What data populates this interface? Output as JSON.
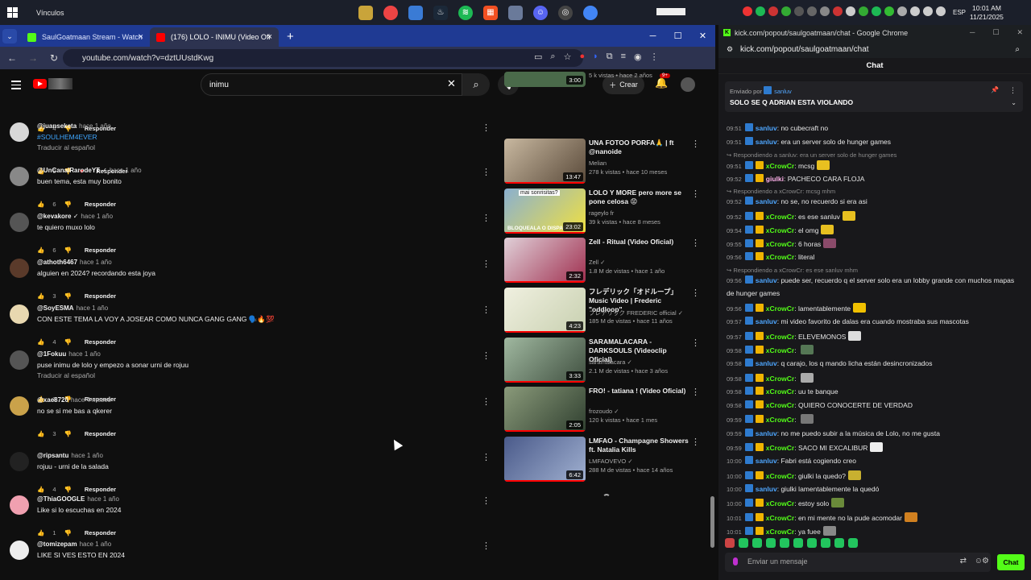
{
  "taskbar": {
    "bookmarks_label": "Vínculos",
    "lang": "ESP",
    "time": "10:01 AM",
    "date": "11/21/2025"
  },
  "browser": {
    "tabs": [
      {
        "label": "SaulGoatmaan Stream - Watch",
        "close": "×"
      },
      {
        "label": "(176) LOLO - INIMU (Video Ofi",
        "close": "×"
      }
    ],
    "new_tab": "+",
    "url": "youtube.com/watch?v=dztUUstdKwg"
  },
  "youtube": {
    "search_value": "inimu",
    "create_label": "Crear",
    "notif_count": "9+",
    "reply_label": "Responder",
    "translate_label": "Traducir al español",
    "first_likes": "4",
    "comments": [
      {
        "user": "@juanseketa",
        "ago": "hace 1 año",
        "text": "#SOULHEM4EVER",
        "link": true,
        "translate": true,
        "likes": "9",
        "creator_heart": true
      },
      {
        "user": "@UnCanalRarodeYT ✓",
        "ago": "hace 1 año",
        "text": "buen tema, esta muy bonito",
        "likes": "6"
      },
      {
        "user": "@kevakore ✓",
        "ago": "hace 1 año",
        "text": "te quiero muxo lolo",
        "likes": "6"
      },
      {
        "user": "@athoth6467",
        "ago": "hace 1 año",
        "text": "alguien en 2024? recordando esta joya",
        "likes": "3"
      },
      {
        "user": "@SoyESMA",
        "ago": "hace 1 año",
        "text": "CON ESTE TEMA LA VOY A JOSEAR COMO NUNCA GANG GANG 🗣️🔥💯",
        "likes": "4"
      },
      {
        "user": "@1Fokuu",
        "ago": "hace 1 año",
        "text": "puse inimu de lolo y empezo a sonar urni de rojuu",
        "translate": true,
        "likes": "3"
      },
      {
        "user": "@xae8720",
        "ago": "hace 4 meses",
        "text": "no se si me bas a qkerer",
        "likes": "3"
      },
      {
        "user": "@ripsantu",
        "ago": "hace 1 año",
        "text": "rojuu - urni de la salada",
        "likes": "4"
      },
      {
        "user": "@ThiaGOOGLE",
        "ago": "hace 1 año",
        "text": "Like si lo escuchas en 2024",
        "likes": "1"
      },
      {
        "user": "@tomizepam",
        "ago": "hace 1 año",
        "text": "LIKE SI VES ESTO EN 2024",
        "likes": ""
      }
    ],
    "top_partial": {
      "meta": "5 k vistas • hace 2 años",
      "duration": "3:00"
    },
    "videos": [
      {
        "title": "UNA FOTOO PORFA🙏 | ft @nanoide",
        "channel": "Melian",
        "meta": "278 k vistas • hace 10 meses",
        "duration": "13:47",
        "thumb_text": ""
      },
      {
        "title": "LOLO Y MORE pero more se pone celosa 😡",
        "channel": "rageylo fr",
        "meta": "39 k vistas • hace 8 meses",
        "duration": "23:02",
        "thumb_text": "mai sonrisitas?",
        "thumb_text2": "BLOQUEALA O DISPARO"
      },
      {
        "title": "Zell - Ritual (Video Oficial)",
        "channel": "Zell ✓",
        "meta": "1.8 M de vistas • hace 1 año",
        "duration": "2:32"
      },
      {
        "title": "フレデリック「オドループ」Music Video | Frederic \"oddloop\"",
        "channel": "フレデリック FREDERIC official ✓",
        "meta": "185 M de vistas • hace 11 años",
        "duration": "4:23"
      },
      {
        "title": "SARAMALACARA - DARKSOULS (Videoclip Oficial)",
        "channel": "saramalacara ✓",
        "meta": "2.1 M de vistas • hace 3 años",
        "duration": "3:33"
      },
      {
        "title": "FRO! - tatiana ! (Video Oficial)",
        "channel": "frozoudo ✓",
        "meta": "120 k vistas • hace 1 mes",
        "duration": "2:05"
      },
      {
        "title": "LMFAO - Champagne Showers ft. Natalia Kills",
        "channel": "LMFAOVEVO ✓",
        "meta": "288 M de vistas • hace 14 años",
        "duration": "6:42"
      }
    ]
  },
  "kick": {
    "window_title": "kick.com/popout/saulgoatmaan/chat - Google Chrome",
    "url": "kick.com/popout/saulgoatmaan/chat",
    "header": "Chat",
    "pinned": {
      "by_prefix": "Enviado por",
      "by_user": "sanluv",
      "message": "SOLO SE Q ADRIAN ESTA VIOLANDO"
    },
    "messages": [
      {
        "ts": "09:51",
        "user": "sanluv",
        "color": "blue",
        "text": "no cubecraft no"
      },
      {
        "ts": "09:51",
        "user": "sanluv",
        "color": "blue",
        "text": "era un server solo de hunger games"
      },
      {
        "reply": "Respondiendo a sanluv: era un server solo de hunger games"
      },
      {
        "ts": "09:51",
        "user": "xCrowCr",
        "color": "green",
        "gold": true,
        "text": "mcsg",
        "emote": "#e8c020"
      },
      {
        "ts": "09:52",
        "user": "giulki",
        "color": "pink",
        "gold": true,
        "text": "PACHECO CARA FLOJA"
      },
      {
        "reply": "Respondiendo a xCrowCr: mcsg mhm"
      },
      {
        "ts": "09:52",
        "user": "sanluv",
        "color": "blue",
        "text": "no se, no recuerdo si era asi"
      },
      {
        "ts": "09:52",
        "user": "xCrowCr",
        "color": "green",
        "gold": true,
        "text": "es ese sanluv",
        "emote": "#e8c020"
      },
      {
        "ts": "09:54",
        "user": "xCrowCr",
        "color": "green",
        "gold": true,
        "text": "el omg",
        "emote": "#e8c020"
      },
      {
        "ts": "09:55",
        "user": "xCrowCr",
        "color": "green",
        "gold": true,
        "text": "6 horas",
        "emote": "#8a4a6a"
      },
      {
        "ts": "09:56",
        "user": "xCrowCr",
        "color": "green",
        "gold": true,
        "text": "literal"
      },
      {
        "reply": "Respondiendo a xCrowCr: es ese sanluv mhm"
      },
      {
        "ts": "09:56",
        "user": "sanluv",
        "color": "blue",
        "text": "puede ser, recuerdo q el server solo era un lobby grande con muchos mapas"
      },
      {
        "cont": "de hunger games"
      },
      {
        "ts": "09:56",
        "user": "xCrowCr",
        "color": "green",
        "gold": true,
        "text": "lamentablemente",
        "emote": "#f0c000"
      },
      {
        "ts": "09:57",
        "user": "sanluv",
        "color": "blue",
        "text": "mi video favorito de dalas era cuando mostraba sus mascotas"
      },
      {
        "ts": "09:57",
        "user": "xCrowCr",
        "color": "green",
        "gold": true,
        "text": "ELEVEMONOS",
        "emote": "#dddddd"
      },
      {
        "ts": "09:58",
        "user": "xCrowCr",
        "color": "green",
        "gold": true,
        "text": "",
        "emote": "#557755"
      },
      {
        "ts": "09:58",
        "user": "sanluv",
        "color": "blue",
        "text": "q carajo, los             q mando licha están desincronizados"
      },
      {
        "ts": "09:58",
        "user": "xCrowCr",
        "color": "green",
        "gold": true,
        "text": "",
        "emote": "#aaaaaa"
      },
      {
        "ts": "09:58",
        "user": "xCrowCr",
        "color": "green",
        "gold": true,
        "text": "uu te banque"
      },
      {
        "ts": "09:58",
        "user": "xCrowCr",
        "color": "green",
        "gold": true,
        "text": "QUIERO CONOCERTE DE VERDAD"
      },
      {
        "ts": "09:59",
        "user": "xCrowCr",
        "color": "green",
        "gold": true,
        "text": "",
        "emote": "#777777"
      },
      {
        "ts": "09:59",
        "user": "sanluv",
        "color": "blue",
        "text": "no me puedo subir a la música de Lolo, no me gusta"
      },
      {
        "ts": "09:59",
        "user": "xCrowCr",
        "color": "green",
        "gold": true,
        "text": "SACO MI EXCALIBUR",
        "emote": "#eeeeee"
      },
      {
        "ts": "10:00",
        "user": "sanluv",
        "color": "blue",
        "text": "Fabri está cogiendo creo"
      },
      {
        "ts": "10:00",
        "user": "xCrowCr",
        "color": "green",
        "gold": true,
        "text": "giulki la quedo?",
        "emote": "#c8b030"
      },
      {
        "ts": "10:00",
        "user": "sanluv",
        "color": "blue",
        "text": "giulki lamentablemente la quedó"
      },
      {
        "ts": "10:00",
        "user": "xCrowCr",
        "color": "green",
        "gold": true,
        "text": "estoy solo",
        "emote": "#6a8a3a"
      },
      {
        "ts": "10:01",
        "user": "xCrowCr",
        "color": "green",
        "gold": true,
        "text": "en mi mente no la pude acomodar",
        "emote": "#d08020"
      },
      {
        "ts": "10:01",
        "user": "xCrowCr",
        "color": "green",
        "gold": true,
        "text": "ya fuee",
        "emote": "#888888"
      }
    ],
    "input_placeholder": "Enviar un mensaje",
    "send_label": "Chat"
  }
}
